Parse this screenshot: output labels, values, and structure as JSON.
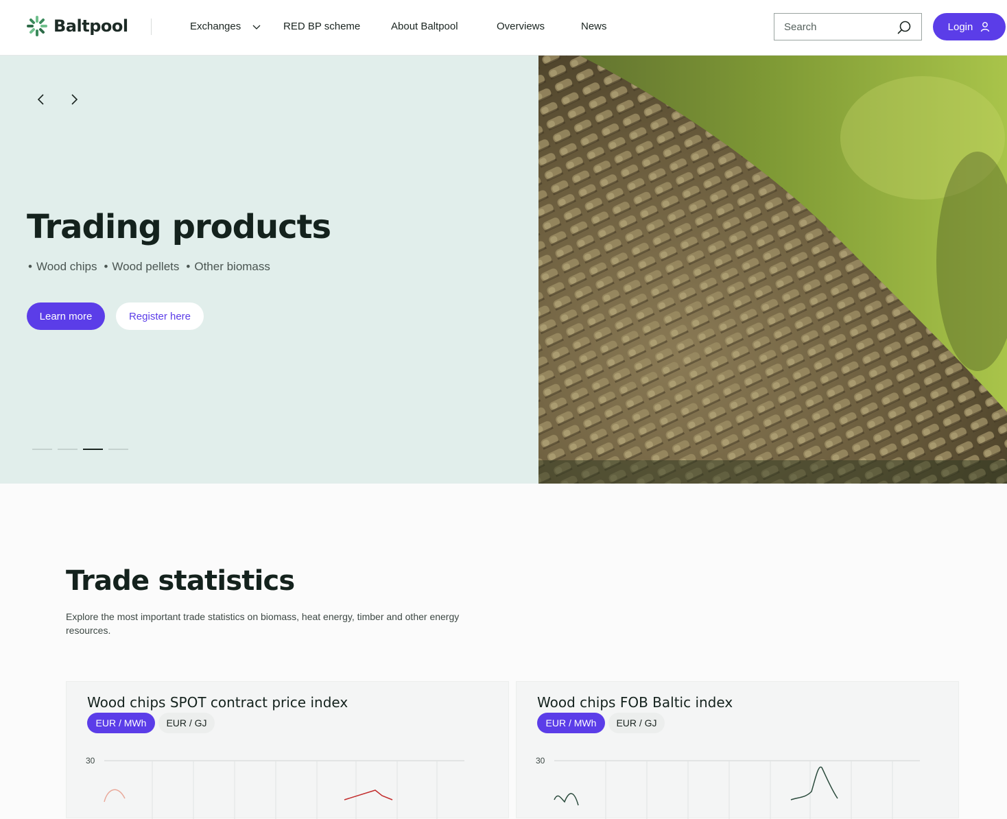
{
  "header": {
    "logo_text": "Baltpool",
    "nav": [
      {
        "label": "Exchanges"
      },
      {
        "label": "RED BP scheme"
      },
      {
        "label": "About Baltpool"
      },
      {
        "label": "Overviews"
      },
      {
        "label": "News"
      }
    ],
    "search_placeholder": "Search",
    "login_label": "Login"
  },
  "hero": {
    "title": "Trading products",
    "products": [
      "Wood chips",
      "Wood pellets",
      "Other biomass"
    ],
    "learn_more": "Learn more",
    "register": "Register here",
    "slide_count": 4,
    "active_slide": 3,
    "background": "#e1eeeb"
  },
  "stats": {
    "title": "Trade statistics",
    "description": "Explore the most important trade statistics on biomass, heat energy, timber and other energy resources."
  },
  "cards": [
    {
      "title": "Wood chips SPOT contract price index",
      "units": [
        "EUR / MWh",
        "EUR / GJ"
      ],
      "y_tick": "30"
    },
    {
      "title": "Wood chips FOB Baltic index",
      "units": [
        "EUR / MWh",
        "EUR / GJ"
      ],
      "y_tick": "30"
    }
  ],
  "colors": {
    "accent": "#5b3de8",
    "dark": "#14221d"
  }
}
